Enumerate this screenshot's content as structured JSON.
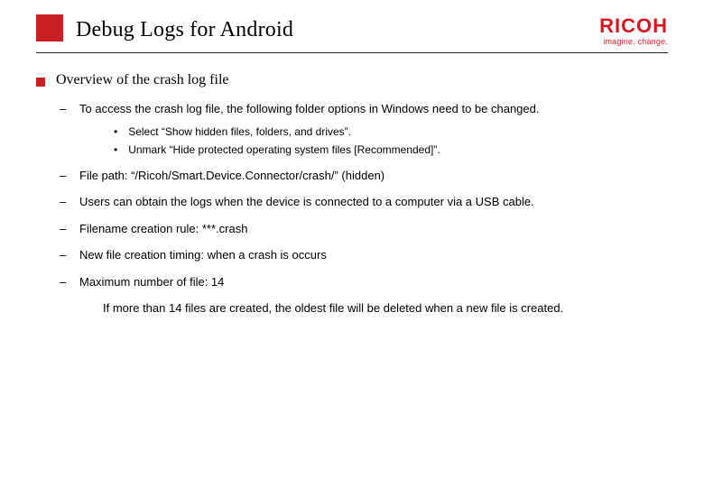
{
  "header": {
    "title": "Debug Logs for Android",
    "logo_main": "RICOH",
    "logo_sub": "imagine. change."
  },
  "content": {
    "overview_label": "Overview of the crash log file",
    "items": [
      {
        "text": "To access the crash log file, the following folder options in Windows need to be changed.",
        "sub": [
          "Select “Show hidden files, folders, and drives”.",
          "Unmark “Hide protected operating system files [Recommended]”."
        ]
      },
      {
        "text": "File path: “/Ricoh/Smart.Device.Connector/crash/” (hidden)"
      },
      {
        "text": "Users can obtain the logs when the device is connected to a computer via a USB cable."
      },
      {
        "text": "Filename creation rule: ***.crash"
      },
      {
        "text": "New file creation timing: when a crash is occurs"
      },
      {
        "text": "Maximum number of file: 14"
      }
    ],
    "note": "If more than 14 files are created, the oldest file will be deleted when a new file is created."
  }
}
